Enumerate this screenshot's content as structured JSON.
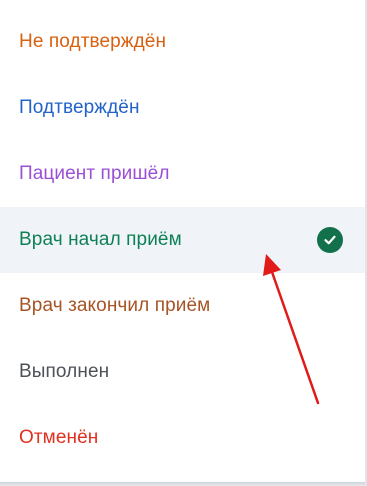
{
  "status_menu": {
    "items": [
      {
        "label": "Не подтверждён",
        "color": "#d9600f"
      },
      {
        "label": "Подтверждён",
        "color": "#2163c9"
      },
      {
        "label": "Пациент пришёл",
        "color": "#9a4fd6"
      },
      {
        "label": "Врач начал приём",
        "color": "#0f7f55",
        "selected": true
      },
      {
        "label": "Врач закончил приём",
        "color": "#a75425"
      },
      {
        "label": "Выполнен",
        "color": "#4c5258"
      },
      {
        "label": "Отменён",
        "color": "#e0311f"
      }
    ],
    "selected_index": 3,
    "check_color": "#12704b",
    "icons": {
      "selected_check": "check-circle-icon",
      "annotation_arrow": "red-arrow"
    },
    "annotation_color": "#e11a1a"
  }
}
